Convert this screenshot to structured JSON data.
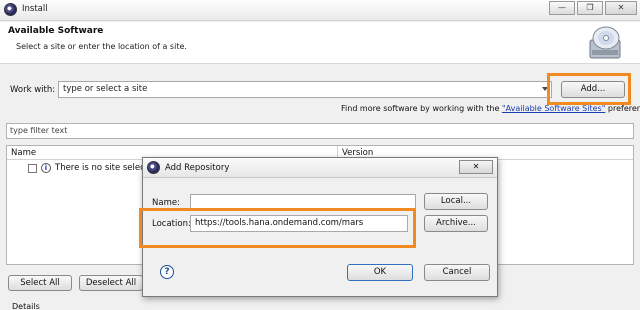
{
  "window": {
    "title": "Install",
    "minimize_glyph": "—",
    "restore_glyph": "❐",
    "close_glyph": "✕"
  },
  "header": {
    "title": "Available Software",
    "subtitle": "Select a site or enter the location of a site.",
    "icon": "cd-install-icon"
  },
  "work_with": {
    "label": "Work with:",
    "placeholder": "type or select a site",
    "add_button": "Add...",
    "find_prefix": "Find more software by working with the ",
    "find_link": "\"Available Software Sites\"",
    "find_suffix": " preferences."
  },
  "filter": {
    "placeholder": "type filter text"
  },
  "table": {
    "columns": [
      "Name",
      "Version"
    ],
    "rows": [
      {
        "text": "There is no site selected."
      }
    ]
  },
  "buttons": {
    "select_all": "Select All",
    "deselect_all": "Deselect All"
  },
  "details_label": "Details",
  "dialog": {
    "title": "Add Repository",
    "close_glyph": "✕",
    "name_label": "Name:",
    "name_value": "",
    "local_button": "Local...",
    "location_label": "Location:",
    "location_value": "https://tools.hana.ondemand.com/mars",
    "archive_button": "Archive...",
    "help_glyph": "?",
    "ok_button": "OK",
    "cancel_button": "Cancel"
  },
  "colors": {
    "highlight": "#f28a22",
    "link": "#1a3cb4",
    "primary_button_border": "#2f6fbf"
  }
}
